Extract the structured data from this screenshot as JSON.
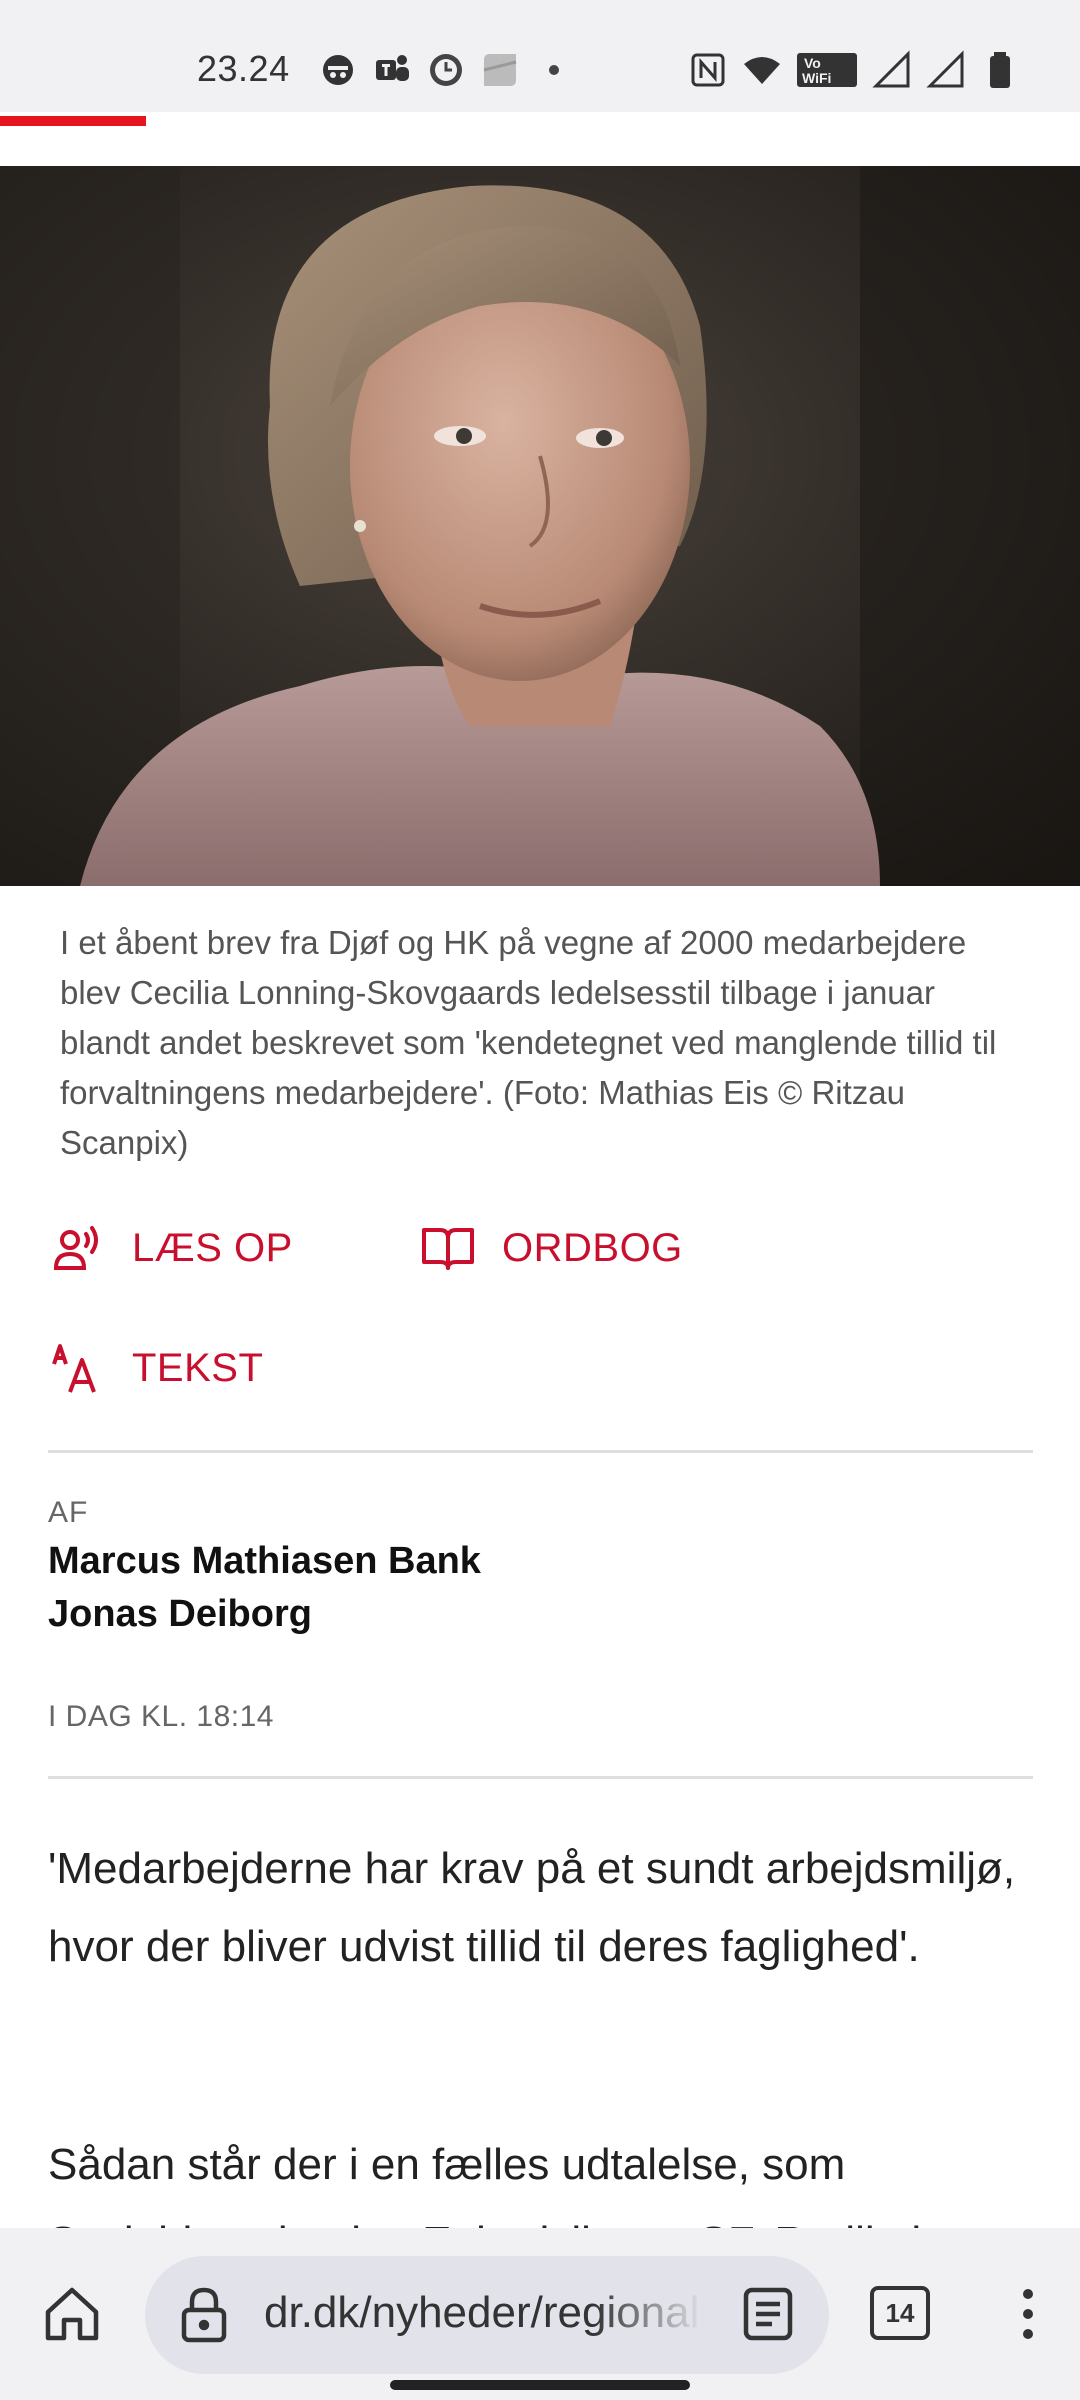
{
  "status_bar": {
    "time": "23.24",
    "left_icons": [
      "incognito-icon",
      "teams-icon",
      "clock-app-icon",
      "app-icon",
      "dot-icon"
    ],
    "right_icons": [
      "nfc-icon",
      "wifi-icon",
      "vowifi-icon",
      "signal-icon",
      "signal-icon-2",
      "battery-icon"
    ],
    "vowifi_label_top": "Vo",
    "vowifi_label_bottom": "WiFi"
  },
  "reading_progress": 0.135,
  "colors": {
    "accent": "#c8102e",
    "progress": "#e6141e"
  },
  "article": {
    "image_caption": "I et åbent brev fra Djøf og HK på vegne af 2000 medarbejdere blev Cecilia Lonning-Skovgaards ledelsesstil tilbage i januar blandt andet beskrevet som 'kendetegnet ved manglende tillid til forvaltningens medarbejdere'. (Foto: Mathias Eis © Ritzau Scanpix)",
    "actions": {
      "read_aloud": "LÆS OP",
      "dictionary": "ORDBOG",
      "text_size": "TEKST"
    },
    "byline_label": "AF",
    "authors": [
      "Marcus Mathiasen Bank",
      "Jonas Deiborg"
    ],
    "timestamp": "I DAG KL. 18:14",
    "paragraphs": [
      "'Medarbejderne har krav på et sundt arbejdsmiljø, hvor der bliver udvist tillid til deres faglighed'.",
      "Sådan står der i en fælles udtalelse, som Socialdemokratiet, Enhedslisten, SF, Radikale"
    ]
  },
  "browser": {
    "url": "dr.dk/nyheder/regionale",
    "tab_count": "14"
  }
}
